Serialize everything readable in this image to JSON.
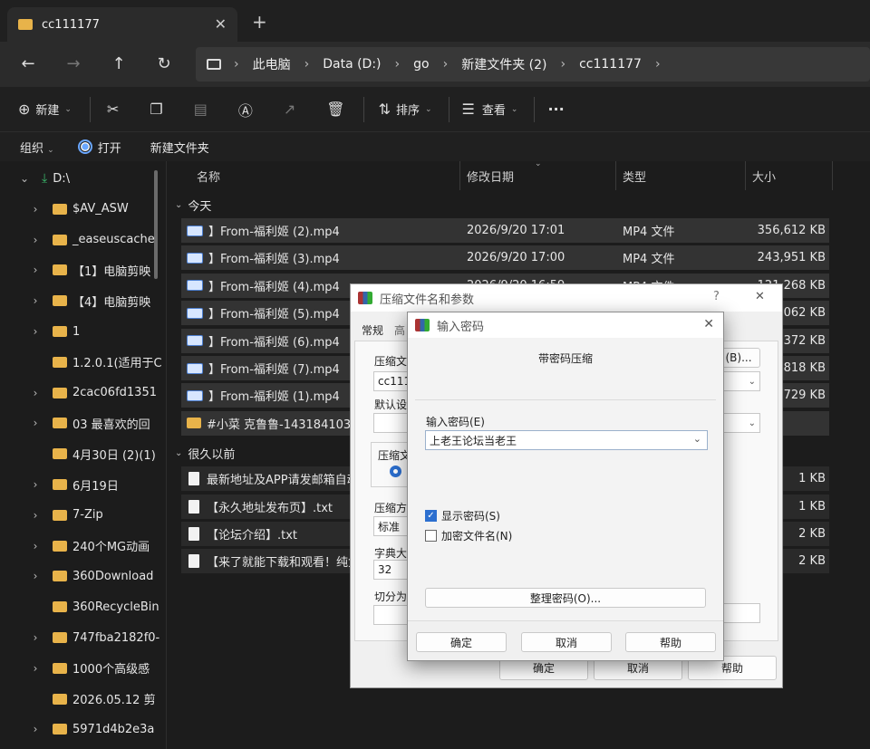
{
  "window": {
    "tab_title": "cc111177",
    "tab_close": "✕",
    "new_tab": "+",
    "controls": {
      "minimize": "—",
      "maximize": "☐",
      "close": "✕"
    }
  },
  "nav": {
    "back": "←",
    "forward": "→",
    "up": "↑",
    "refresh": "↻",
    "breadcrumbs": [
      "此电脑",
      "Data (D:)",
      "go",
      "新建文件夹 (2)",
      "cc111177"
    ],
    "separator": "›"
  },
  "toolbar": {
    "new_label": "新建",
    "sort_label": "排序",
    "view_label": "查看",
    "more_label": "···"
  },
  "menubar": {
    "organize": "组织",
    "open": "打开",
    "new_folder": "新建文件夹"
  },
  "sidebar": {
    "items": [
      {
        "label": "D:\\",
        "expanded": true,
        "drive": true
      },
      {
        "label": "$AV_ASW",
        "chevron": true
      },
      {
        "label": "_easeuscache",
        "chevron": true
      },
      {
        "label": "【1】电脑剪映",
        "chevron": true
      },
      {
        "label": "【4】电脑剪映",
        "chevron": true
      },
      {
        "label": "1",
        "chevron": true
      },
      {
        "label": "1.2.0.1(适用于C",
        "chevron": false
      },
      {
        "label": "2cac06fd1351",
        "chevron": true
      },
      {
        "label": "03 最喜欢的回",
        "chevron": true
      },
      {
        "label": "4月30日 (2)(1)",
        "chevron": false
      },
      {
        "label": "6月19日",
        "chevron": true
      },
      {
        "label": "7-Zip",
        "chevron": true
      },
      {
        "label": "240个MG动画",
        "chevron": true
      },
      {
        "label": "360Download",
        "chevron": true
      },
      {
        "label": "360RecycleBin",
        "chevron": false
      },
      {
        "label": "747fba2182f0-",
        "chevron": true
      },
      {
        "label": "1000个高级感",
        "chevron": true
      },
      {
        "label": "2026.05.12 剪",
        "chevron": false
      },
      {
        "label": "5971d4b2e3a",
        "chevron": true
      }
    ]
  },
  "filelist": {
    "columns": {
      "name": "名称",
      "date": "修改日期",
      "type": "类型",
      "size": "大小"
    },
    "groups": [
      {
        "label": "今天",
        "rows": [
          {
            "name": "】From-福利姬 (2).mp4",
            "date": "2026/9/20 17:01",
            "type": "MP4 文件",
            "size": "356,612 KB",
            "icon": "video"
          },
          {
            "name": "】From-福利姬 (3).mp4",
            "date": "2026/9/20 17:00",
            "type": "MP4 文件",
            "size": "243,951 KB",
            "icon": "video"
          },
          {
            "name": "】From-福利姬 (4).mp4",
            "date": "2026/9/20 16:59",
            "type": "MP4 文件",
            "size": "121,268 KB",
            "icon": "video"
          },
          {
            "name": "】From-福利姬 (5).mp4",
            "date": "",
            "type": "",
            "size": "062 KB",
            "icon": "video"
          },
          {
            "name": "】From-福利姬 (6).mp4",
            "date": "",
            "type": "",
            "size": "372 KB",
            "icon": "video"
          },
          {
            "name": "】From-福利姬 (7).mp4",
            "date": "",
            "type": "",
            "size": "818 KB",
            "icon": "video"
          },
          {
            "name": "】From-福利姬 (1).mp4",
            "date": "",
            "type": "",
            "size": "729 KB",
            "icon": "video"
          },
          {
            "name": "#小菜 克鲁鲁-1431841038",
            "date": "",
            "type": "",
            "size": "",
            "icon": "folder"
          }
        ]
      },
      {
        "label": "很久以前",
        "rows": [
          {
            "name": "最新地址及APP请发邮箱自动",
            "date": "",
            "type": "",
            "size": "1 KB",
            "icon": "text"
          },
          {
            "name": "【永久地址发布页】.txt",
            "date": "",
            "type": "",
            "size": "1 KB",
            "icon": "text"
          },
          {
            "name": "【论坛介绍】.txt",
            "date": "",
            "type": "",
            "size": "2 KB",
            "icon": "text"
          },
          {
            "name": "【来了就能下载和观看！纯免",
            "date": "",
            "type": "",
            "size": "2 KB",
            "icon": "text"
          }
        ]
      }
    ]
  },
  "back_dialog": {
    "title": "压缩文件名和参数",
    "help_mark": "?",
    "close": "✕",
    "tab_general": "常规",
    "tab_adv": "高",
    "archive_label": "压缩文",
    "archive_value": "cc111",
    "browse_label": "(B)...",
    "default_label": "默认设",
    "format_label": "压缩文",
    "method_label": "压缩方",
    "method_value": "标准",
    "dict_label": "字典大",
    "dict_value": "32",
    "split_label": "切分为",
    "ok": "确定",
    "cancel": "取消",
    "help": "帮助"
  },
  "front_dialog": {
    "title": "输入密码",
    "close": "✕",
    "heading": "带密码压缩",
    "password_label": "输入密码(E)",
    "password_value": "上老王论坛当老王",
    "show_password": "显示密码(S)",
    "encrypt_names": "加密文件名(N)",
    "manage": "整理密码(O)...",
    "ok": "确定",
    "cancel": "取消",
    "help": "帮助"
  }
}
